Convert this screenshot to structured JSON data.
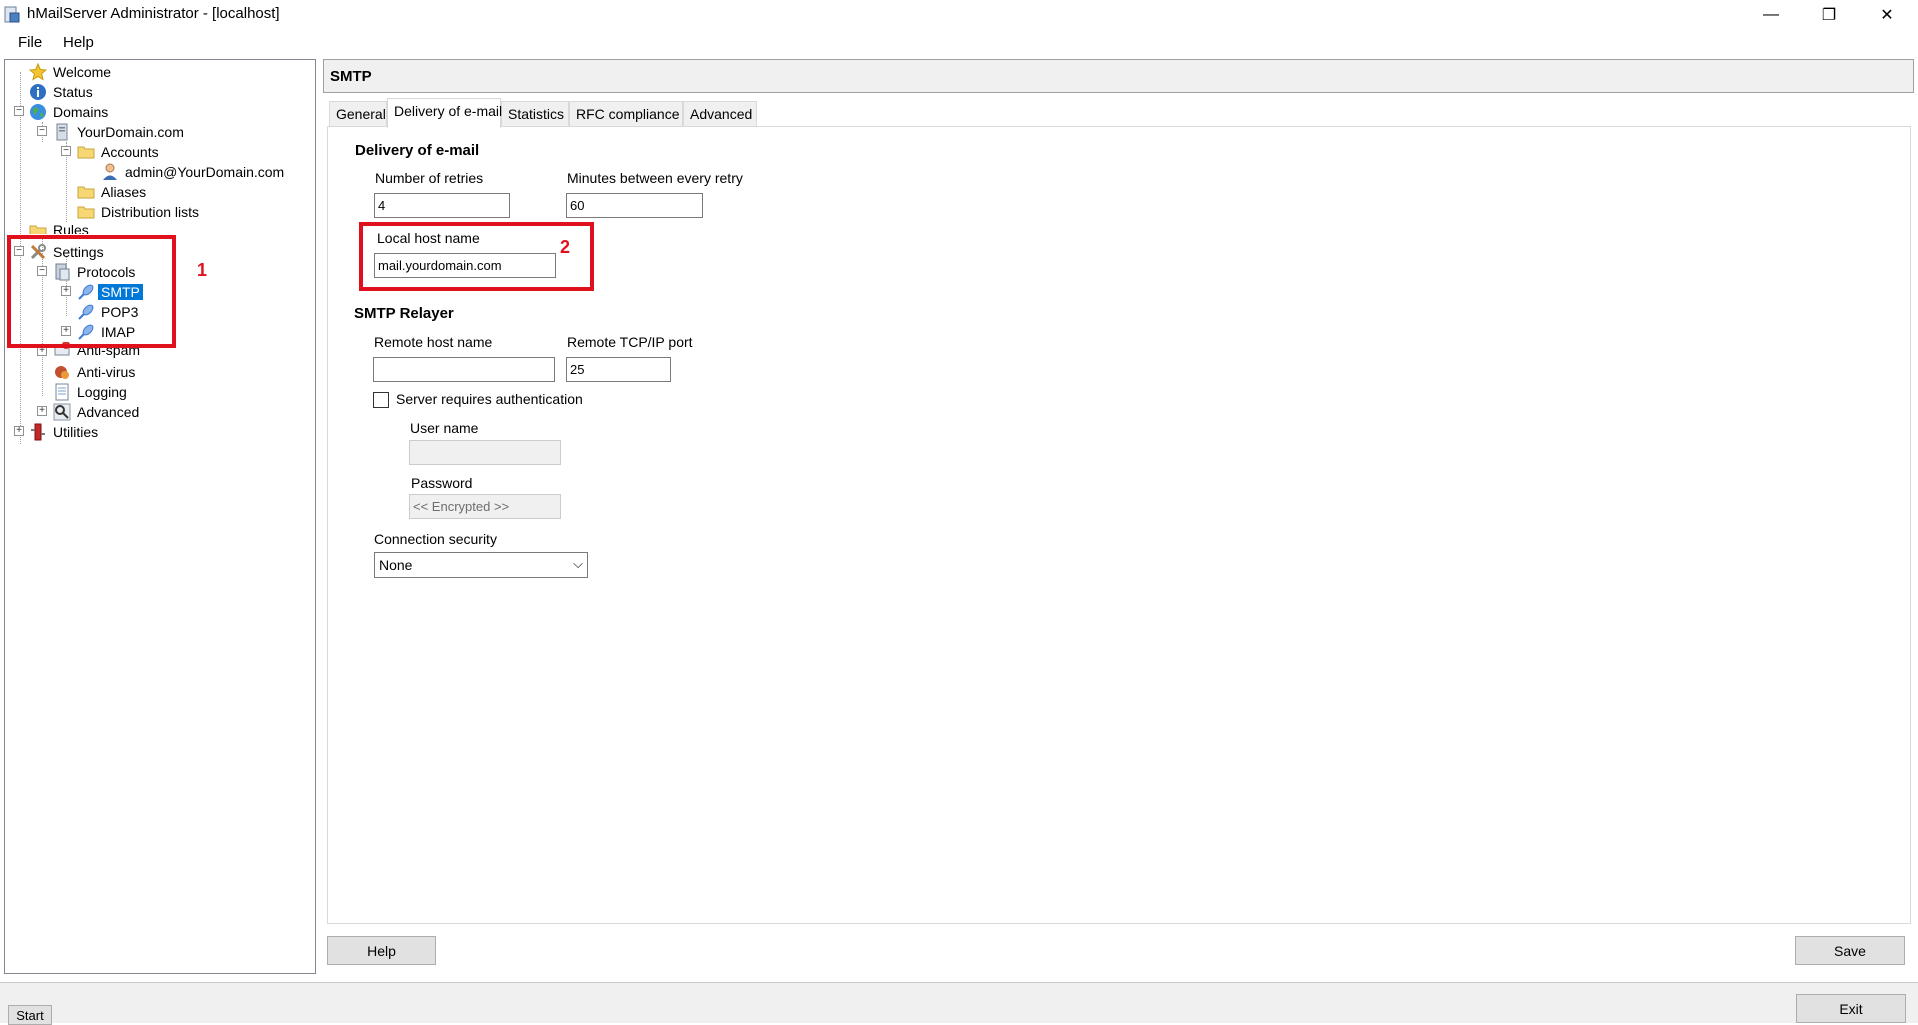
{
  "window": {
    "title": "hMailServer Administrator - [localhost]",
    "minimize": "—",
    "maximize": "❐",
    "close": "✕"
  },
  "menu": {
    "file": "File",
    "help": "Help"
  },
  "tree": {
    "welcome": "Welcome",
    "status": "Status",
    "domains": "Domains",
    "domain": "YourDomain.com",
    "accounts": "Accounts",
    "admin": "admin@YourDomain.com",
    "aliases": "Aliases",
    "distribution_lists": "Distribution lists",
    "rules": "Rules",
    "settings": "Settings",
    "protocols": "Protocols",
    "smtp": "SMTP",
    "pop3": "POP3",
    "imap": "IMAP",
    "antispam": "Anti-spam",
    "antivirus": "Anti-virus",
    "logging": "Logging",
    "advanced": "Advanced",
    "utilities": "Utilities"
  },
  "panel": {
    "title": "SMTP",
    "tabs": [
      "General",
      "Delivery of e-mail",
      "Statistics",
      "RFC compliance",
      "Advanced"
    ],
    "active_tab": "Delivery of e-mail"
  },
  "delivery": {
    "section": "Delivery of e-mail",
    "retries_label": "Number of retries",
    "retries_value": "4",
    "minutes_label": "Minutes between every retry",
    "minutes_value": "60",
    "hostname_label": "Local host name",
    "hostname_value": "mail.yourdomain.com"
  },
  "relayer": {
    "section": "SMTP Relayer",
    "remote_host_label": "Remote host name",
    "remote_host_value": "",
    "port_label": "Remote TCP/IP port",
    "port_value": "25",
    "auth_label": "Server requires authentication",
    "auth_checked": false,
    "username_label": "User name",
    "username_value": "",
    "password_label": "Password",
    "password_value": "<< Encrypted >>",
    "security_label": "Connection security",
    "security_value": "None"
  },
  "buttons": {
    "help": "Help",
    "save": "Save",
    "exit": "Exit",
    "start": "Start"
  },
  "annotations": {
    "one": "1",
    "two": "2"
  },
  "colors": {
    "annotation_red": "#e0111d",
    "selection_blue": "#0078d7"
  }
}
